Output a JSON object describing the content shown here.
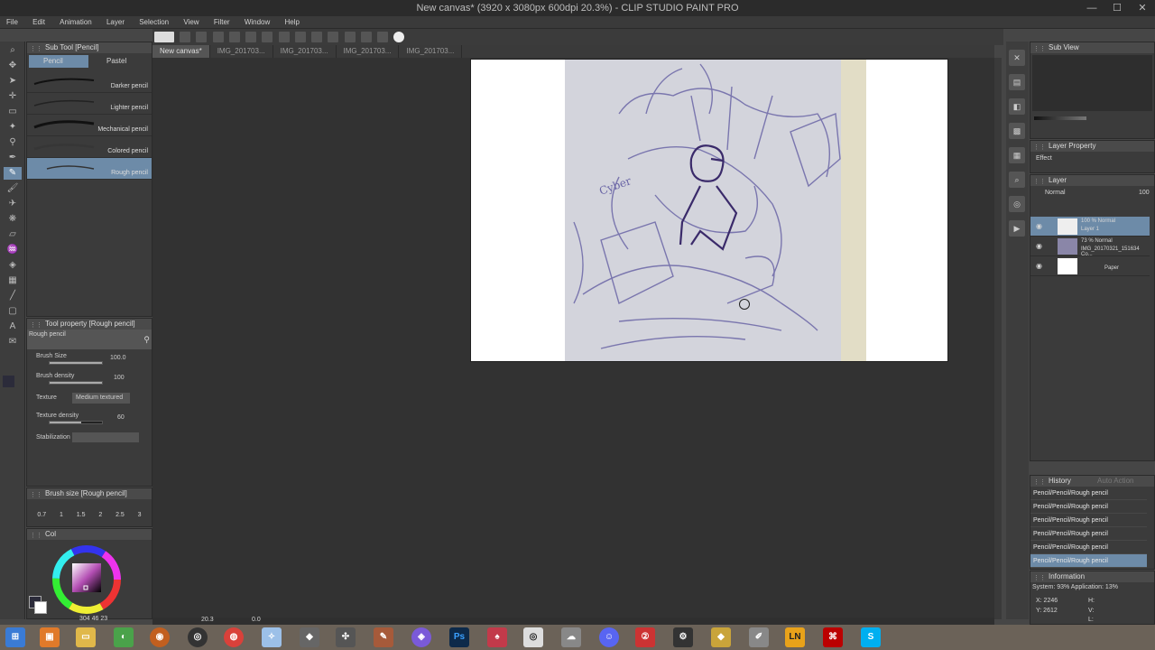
{
  "window": {
    "title": "New canvas* (3920 x 3080px 600dpi 20.3%) - CLIP STUDIO PAINT PRO",
    "minimize": "—",
    "maximize": "☐",
    "close": "✕"
  },
  "menu": [
    "File",
    "Edit",
    "Animation",
    "Layer",
    "Selection",
    "View",
    "Filter",
    "Window",
    "Help"
  ],
  "doc_tabs": [
    "New canvas*",
    "IMG_201703...",
    "IMG_201703...",
    "IMG_201703...",
    "IMG_201703..."
  ],
  "subtool": {
    "header": "Sub Tool [Pencil]",
    "tabs": [
      "Pencil",
      "Pastel"
    ],
    "brushes": [
      "Darker pencil",
      "Lighter pencil",
      "Mechanical pencil",
      "Colored pencil",
      "Rough pencil"
    ],
    "selected_index": 4
  },
  "tool_property": {
    "header": "Tool property [Rough pencil]",
    "preset": "Rough pencil",
    "brush_size_label": "Brush Size",
    "brush_size_value": "100.0",
    "brush_density_label": "Brush density",
    "brush_density_value": "100",
    "texture_label": "Texture",
    "texture_value": "Medium textured",
    "texture_density_label": "Texture density",
    "texture_density_value": "60",
    "stabilization_label": "Stabilization"
  },
  "brush_size_panel": {
    "header": "Brush size [Rough pencil]",
    "sizes": [
      "0.7",
      "1",
      "1.5",
      "2",
      "2.5",
      "3"
    ]
  },
  "color_panel": {
    "header": "Col",
    "readout": "304  46  23",
    "main_color": "#2b2b3a",
    "sub_color": "#ffffff",
    "swatch_color": "#c020a0"
  },
  "sub_view": {
    "header": "Sub View"
  },
  "layer_property": {
    "header": "Layer Property",
    "effect_label": "Effect"
  },
  "layer_panel": {
    "header": "Layer",
    "blend_mode": "Normal",
    "opacity": "100",
    "layers": [
      {
        "line1": "100 % Normal",
        "line2": "Layer 1",
        "selected": true
      },
      {
        "line1": "73 % Normal",
        "line2": "IMG_20170321_151634 Co...",
        "selected": false
      },
      {
        "line1": "",
        "line2": "Paper",
        "selected": false
      }
    ]
  },
  "history": {
    "header": "History",
    "aux": "Auto Action",
    "items": [
      "Pencil/Pencil/Rough pencil",
      "Pencil/Pencil/Rough pencil",
      "Pencil/Pencil/Rough pencil",
      "Pencil/Pencil/Rough pencil",
      "Pencil/Pencil/Rough pencil",
      "Pencil/Pencil/Rough pencil"
    ]
  },
  "information": {
    "header": "Information",
    "system": "System: 93% Application: 13%",
    "x": "X: 2246",
    "y": "Y: 2612",
    "h": "H:",
    "v": "V:",
    "l": "L:"
  },
  "status": {
    "zoom": "20.3",
    "angle": "0.0"
  },
  "taskbar": {
    "apps": [
      "windows-start",
      "file-explorer",
      "folder",
      "paint-palette",
      "obs",
      "chrome",
      "clip-studio",
      "inkscape",
      "sketchbook",
      "pencil",
      "krita",
      "photoshop",
      "manga",
      "clip-studio-2",
      "skype-like",
      "discord",
      "unity",
      "unity-dark",
      "aseprite",
      "mydraw",
      "lightroom-ln",
      "acrobat",
      "skype"
    ],
    "ps_label": "Ps",
    "ln_label": "LN",
    "s_label": "S"
  }
}
